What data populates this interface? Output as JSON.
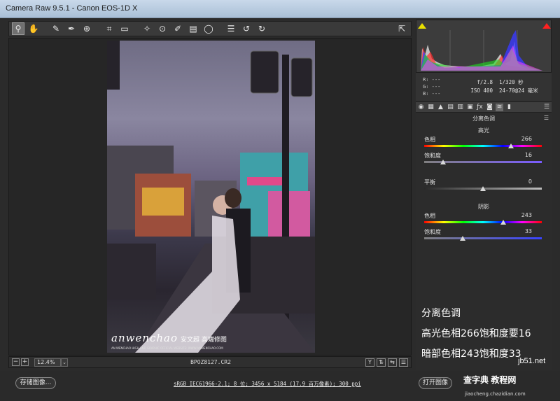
{
  "window": {
    "title": "Camera Raw 9.5.1 -  Canon EOS-1D X"
  },
  "toolbar": {
    "tools": [
      {
        "name": "zoom-tool-icon",
        "glyph": "⚲"
      },
      {
        "name": "hand-tool-icon",
        "glyph": "✋"
      },
      {
        "name": "white-balance-tool-icon",
        "glyph": "✎"
      },
      {
        "name": "color-sampler-tool-icon",
        "glyph": "✒"
      },
      {
        "name": "targeted-adjustment-tool-icon",
        "glyph": "⊕"
      },
      {
        "name": "crop-tool-icon",
        "glyph": "⌗"
      },
      {
        "name": "straighten-tool-icon",
        "glyph": "▭"
      },
      {
        "name": "spot-removal-tool-icon",
        "glyph": "✧"
      },
      {
        "name": "red-eye-removal-tool-icon",
        "glyph": "⊙"
      },
      {
        "name": "adjustment-brush-icon",
        "glyph": "✐"
      },
      {
        "name": "graduated-filter-icon",
        "glyph": "▤"
      },
      {
        "name": "radial-filter-icon",
        "glyph": "◯"
      },
      {
        "name": "preferences-icon",
        "glyph": "☰"
      },
      {
        "name": "rotate-left-icon",
        "glyph": "↺"
      },
      {
        "name": "rotate-right-icon",
        "glyph": "↻"
      }
    ],
    "fullscreen_glyph": "⇱"
  },
  "histogram": {
    "rgb": "R: ---\nG: ---\nB: ---",
    "r_label": "R:",
    "r_value": "---",
    "g_label": "G:",
    "g_value": "---",
    "b_label": "B:",
    "b_value": "---",
    "aperture": "f/2.8",
    "shutter": "1/320 秒",
    "iso": "ISO 400",
    "lens": "24-70@24 毫米"
  },
  "tabs": [
    "◉",
    "▦",
    "▲",
    "▤",
    "▥",
    "▣",
    "ƒx",
    "◙",
    "≋",
    "▮"
  ],
  "split_toning": {
    "title": "分离色调",
    "highlights_title": "高光",
    "shadows_title": "阴影",
    "highlights_hue": {
      "label": "色相",
      "value": 266,
      "min": 0,
      "max": 360
    },
    "highlights_saturation": {
      "label": "饱和度",
      "value": 16,
      "min": 0,
      "max": 100
    },
    "balance": {
      "label": "平衡",
      "value": 0,
      "min": -100,
      "max": 100
    },
    "shadows_hue": {
      "label": "色相",
      "value": 243,
      "min": 0,
      "max": 360
    },
    "shadows_saturation": {
      "label": "饱和度",
      "value": 33,
      "min": 0,
      "max": 100
    }
  },
  "notes": {
    "line1": "分离色调",
    "line2": "高光色相266饱和度要16",
    "line3": "暗部色相243饱和度33"
  },
  "status": {
    "zoom_minus": "−",
    "zoom_plus": "+",
    "zoom": "12.4%",
    "filename": "BPOZ8127.CR2",
    "icons": [
      "Y",
      "⇅",
      "⇆",
      "☰"
    ]
  },
  "bottom": {
    "save_label": "存储图像...",
    "workflow": "sRGB IEC61966-2.1; 8 位; 3456 x 5184 (17.9 百万像素); 300 ppi",
    "open_label": "打开图像"
  },
  "watermark": {
    "brand": "anwenchao",
    "cn": "安文超 高端修图",
    "sub": "AN WENCHAO HIGH-END GRAPHIC  OFFICIAL WEBSITE: WWW.ANWENCHAO.COM"
  },
  "site": {
    "main": "查字典 教程网",
    "top": "jb51.net",
    "url": "jiaocheng.chazidian.com"
  }
}
